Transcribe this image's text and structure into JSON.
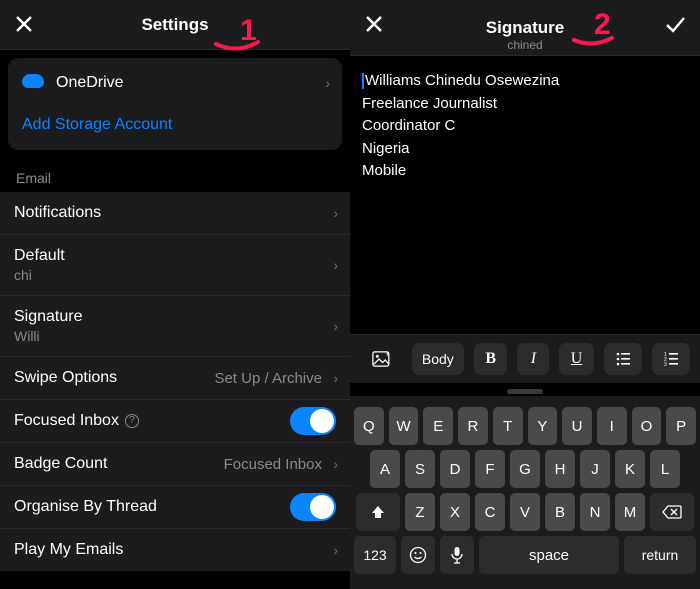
{
  "left": {
    "title": "Settings",
    "storage": {
      "onedrive": "OneDrive",
      "add": "Add Storage Account"
    },
    "section_label": "Email",
    "rows": {
      "notifications": "Notifications",
      "default": "Default",
      "default_sub": "chi",
      "signature": "Signature",
      "signature_sub": "Willi",
      "swipe": "Swipe Options",
      "swipe_detail": "Set Up / Archive",
      "focused": "Focused Inbox",
      "badge": "Badge Count",
      "badge_detail": "Focused Inbox",
      "organise": "Organise By Thread",
      "play": "Play My Emails"
    }
  },
  "right": {
    "title": "Signature",
    "subtitle": "chined",
    "lines": [
      "Williams Chinedu Osewezina",
      "Freelance Journalist",
      "Coordinator C",
      "Nigeria",
      "Mobile"
    ],
    "toolbar": {
      "body": "Body"
    },
    "keyboard": {
      "r1": [
        "Q",
        "W",
        "E",
        "R",
        "T",
        "Y",
        "U",
        "I",
        "O",
        "P"
      ],
      "r2": [
        "A",
        "S",
        "D",
        "F",
        "G",
        "H",
        "J",
        "K",
        "L"
      ],
      "r3": [
        "Z",
        "X",
        "C",
        "V",
        "B",
        "N",
        "M"
      ],
      "num": "123",
      "space": "space",
      "return": "return"
    }
  },
  "annotations": {
    "one": "1",
    "two": "2"
  }
}
